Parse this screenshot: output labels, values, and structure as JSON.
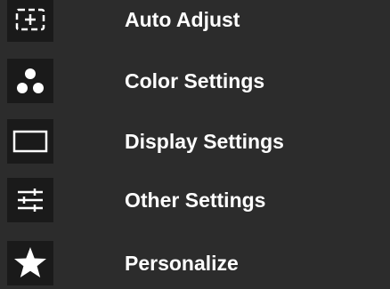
{
  "menu": {
    "items": [
      {
        "label": "Auto Adjust",
        "icon": "auto-adjust-icon"
      },
      {
        "label": "Color Settings",
        "icon": "color-dots-icon"
      },
      {
        "label": "Display Settings",
        "icon": "display-rectangle-icon"
      },
      {
        "label": "Other Settings",
        "icon": "sliders-icon"
      },
      {
        "label": "Personalize",
        "icon": "star-icon"
      }
    ]
  },
  "colors": {
    "background": "#2c2c2c",
    "icon_background": "#1a1a1a",
    "text": "#ffffff"
  }
}
